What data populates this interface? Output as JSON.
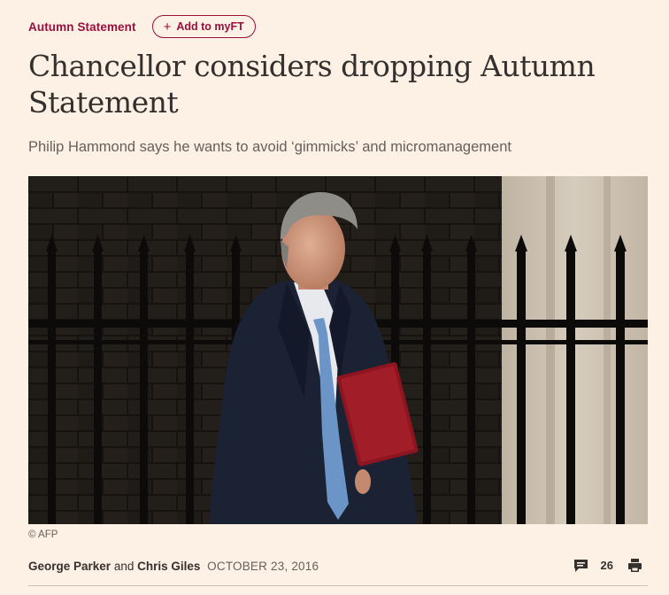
{
  "header": {
    "topic": "Autumn Statement",
    "myft_label": "Add to myFT"
  },
  "article": {
    "headline": "Chancellor considers dropping Autumn Statement",
    "standfirst": "Philip Hammond says he wants to avoid ‘gimmicks’ and micromanagement",
    "image_caption": "© AFP",
    "byline": {
      "author1": "George Parker",
      "joiner": "and",
      "author2": "Chris Giles",
      "date": "OCTOBER 23, 2016"
    },
    "comment_count": "26"
  },
  "icons": {
    "comments": "comments-icon",
    "print": "print-icon"
  },
  "colors": {
    "background": "#fdf0e5",
    "accent": "#990f3d",
    "text": "#33302e",
    "muted": "#66605c"
  }
}
